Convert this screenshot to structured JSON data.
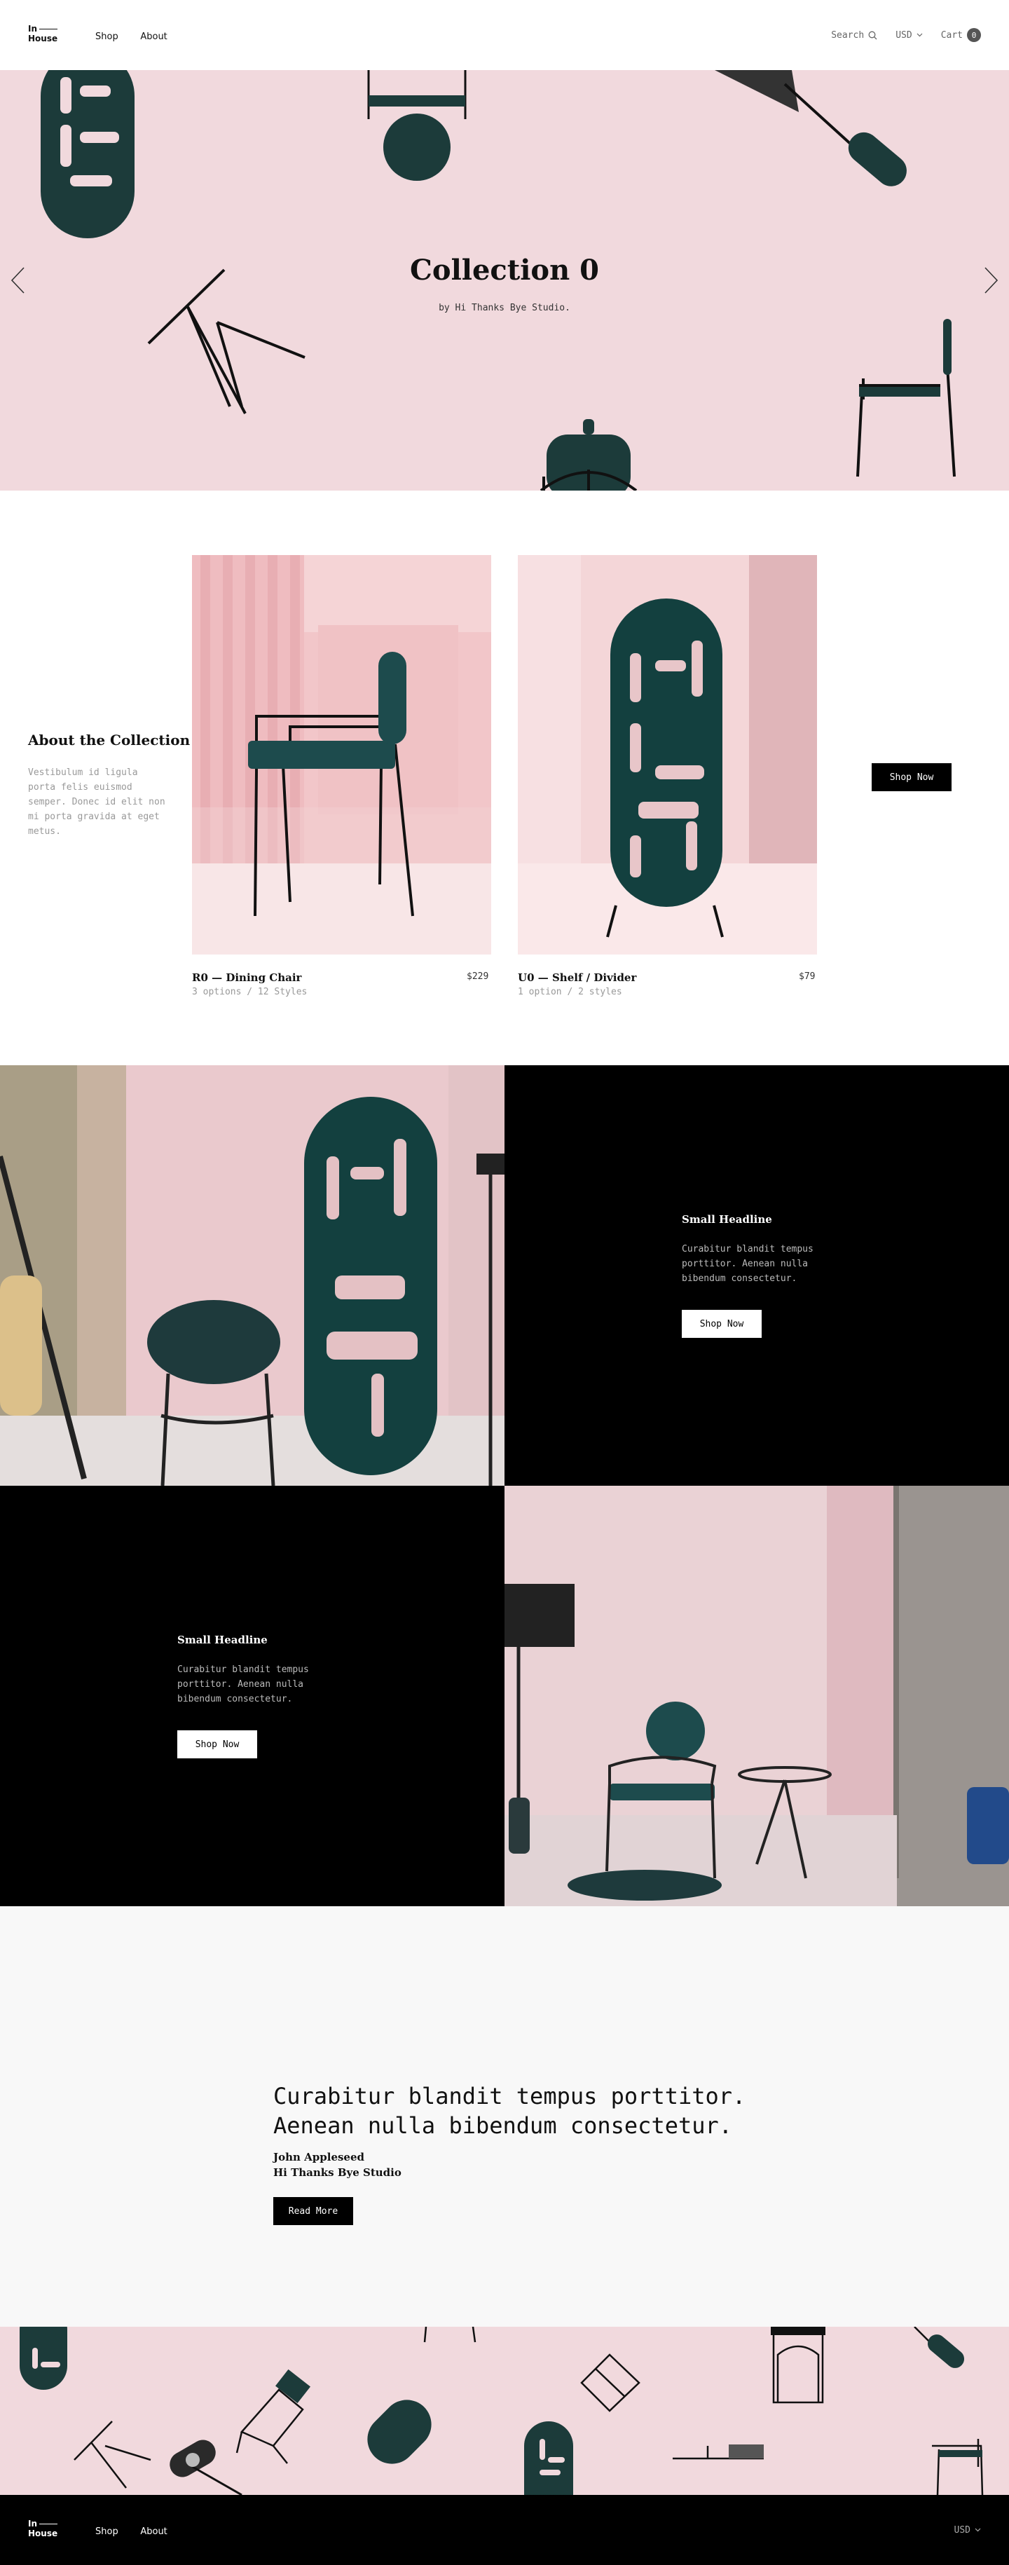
{
  "brand": {
    "logo_line1": "In",
    "logo_line2": "House"
  },
  "nav": [
    {
      "label": "Shop"
    },
    {
      "label": "About"
    }
  ],
  "header": {
    "search_label": "Search",
    "currency": "USD",
    "cart_label": "Cart",
    "cart_count": "0"
  },
  "hero": {
    "title": "Collection 0",
    "subtitle": "by Hi Thanks Bye Studio."
  },
  "collection": {
    "title": "About the Collection",
    "text": "Vestibulum id ligula porta felis euismod semper. Donec id elit non mi porta gravida at eget metus.",
    "cta": "Shop Now",
    "products": [
      {
        "name": "R0 — Dining Chair",
        "price": "$229",
        "meta": "3 options /  12 Styles"
      },
      {
        "name": "U0 — Shelf / Divider",
        "price": "$79",
        "meta": "1 option / 2 styles"
      }
    ]
  },
  "features": [
    {
      "headline": "Small Headline",
      "text": "Curabitur blandit tempus porttitor. Aenean nulla bibendum consectetur.",
      "cta": "Shop Now"
    },
    {
      "headline": "Small Headline",
      "text": "Curabitur blandit tempus porttitor. Aenean nulla bibendum consectetur.",
      "cta": "Shop Now"
    }
  ],
  "quote": {
    "text": "Curabitur blandit tempus porttitor. Aenean nulla bibendum consectetur.",
    "author": "John Appleseed",
    "company": "Hi Thanks Bye Studio",
    "cta": "Read More"
  },
  "footer": {
    "currency": "USD"
  },
  "colors": {
    "pink": "#f1d9dd",
    "dark_green": "#1c3b3a",
    "black": "#000000",
    "quote_bg": "#f8f8f8"
  }
}
